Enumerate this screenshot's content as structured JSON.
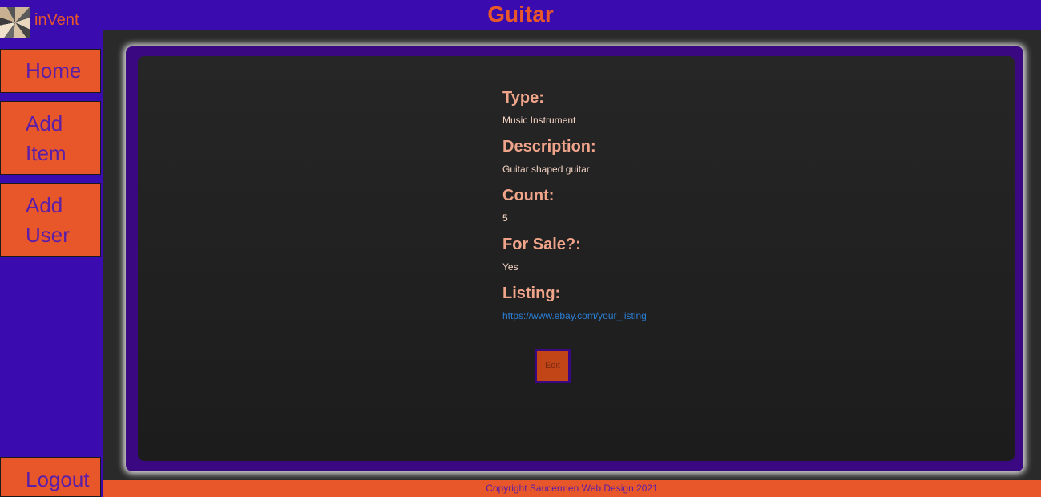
{
  "header": {
    "brand": "inVent",
    "title": "Guitar"
  },
  "sidebar": {
    "items": [
      {
        "label": "Home"
      },
      {
        "label": "Add Item"
      },
      {
        "label": "Add User"
      }
    ],
    "logout_label": "Logout"
  },
  "item": {
    "fields": [
      {
        "label": "Type:",
        "value": "Music Instrument"
      },
      {
        "label": "Description:",
        "value": "Guitar shaped guitar"
      },
      {
        "label": "Count:",
        "value": "5"
      },
      {
        "label": "For Sale?:",
        "value": "Yes"
      },
      {
        "label": "Listing:",
        "value": "https://www.ebay.com/your_listing"
      }
    ],
    "edit_label": "Edit"
  },
  "footer": {
    "copyright": "Copyright Saucermen Web Design 2021"
  },
  "colors": {
    "nav_bg": "#3a0cb0",
    "accent": "#e8572a",
    "panel_bg": "#262626",
    "label_color": "#f0a58a",
    "link_color": "#2b7fd6"
  }
}
